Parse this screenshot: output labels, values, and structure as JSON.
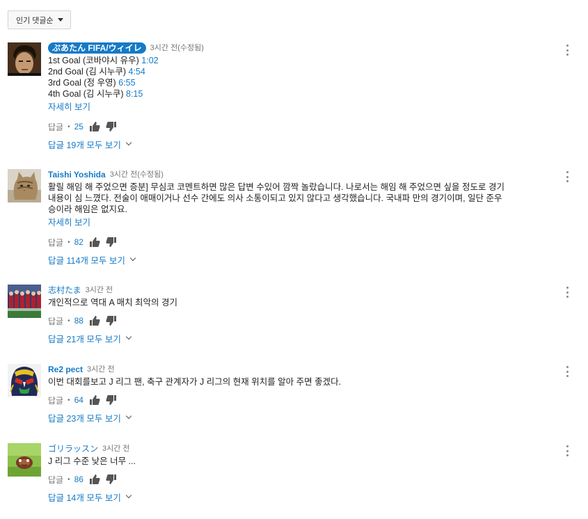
{
  "sort": {
    "label": "인기 댓글순"
  },
  "comments": [
    {
      "author": "ぷあたん FIFA/ウィイレ",
      "time": "3시간 전(수정됨)",
      "lines": [
        {
          "text": "1st Goal (코바야시 유우) ",
          "ts": "1:02"
        },
        {
          "text": "2nd Goal (김 시누쿠) ",
          "ts": "4:54"
        },
        {
          "text": "3rd Goal (정 우영) ",
          "ts": "6:55"
        },
        {
          "text": "4th Goal (김 시누쿠) ",
          "ts": "8:15"
        }
      ],
      "more": "자세히 보기",
      "reply": "답글",
      "likes": "25",
      "replies": "답글 19개 모두 보기"
    },
    {
      "author": "Taishi Yoshida",
      "time": "3시간 전(수정됨)",
      "lines": [
        {
          "text": "활릴 해임 해 주었으면 증분] 무심코 코멘트하면 많은 답변 수있어 깜짝 놀랐습니다. 나로서는 해임 해 주었으면 싶을 정도로 경기",
          "ts": ""
        },
        {
          "text": "내용이 심 느꼈다. 전술이 애매이거나 선수 간에도 의사 소통이되고 있지 않다고 생각했습니다. 국내파 만의 경기이며, 일단 준우",
          "ts": ""
        },
        {
          "text": "승이라 해임은 없지요.",
          "ts": ""
        }
      ],
      "more": "자세히 보기",
      "reply": "답글",
      "likes": "82",
      "replies": "답글 114개 모두 보기"
    },
    {
      "author": "志村たま",
      "time": "3시간 전",
      "lines": [
        {
          "text": "개인적으로 역대 A 매치 최악의 경기",
          "ts": ""
        }
      ],
      "reply": "답글",
      "likes": "88",
      "replies": "답글 21개 모두 보기"
    },
    {
      "author": "Re2 pect",
      "time": "3시간 전",
      "lines": [
        {
          "text": "이번 대회를보고 J 리그 팬, 축구 관계자가 J 리그의 현재 위치를 알아 주면 좋겠다.",
          "ts": ""
        }
      ],
      "reply": "답글",
      "likes": "64",
      "replies": "답글 23개 모두 보기"
    },
    {
      "author": "ゴリラッスン",
      "time": "3시간 전",
      "lines": [
        {
          "text": "J 리그 수준 낮은 너무 ...",
          "ts": ""
        }
      ],
      "reply": "답글",
      "likes": "86",
      "replies": "답글 14개 모두 보기"
    }
  ],
  "colors": {
    "link": "#167ac6",
    "meta": "#767676",
    "icon": "#555555"
  },
  "icons": {
    "like": "thumbs-up-icon",
    "dislike": "thumbs-down-icon",
    "menu": "more-vert-icon",
    "expand": "chevron-down-icon"
  }
}
